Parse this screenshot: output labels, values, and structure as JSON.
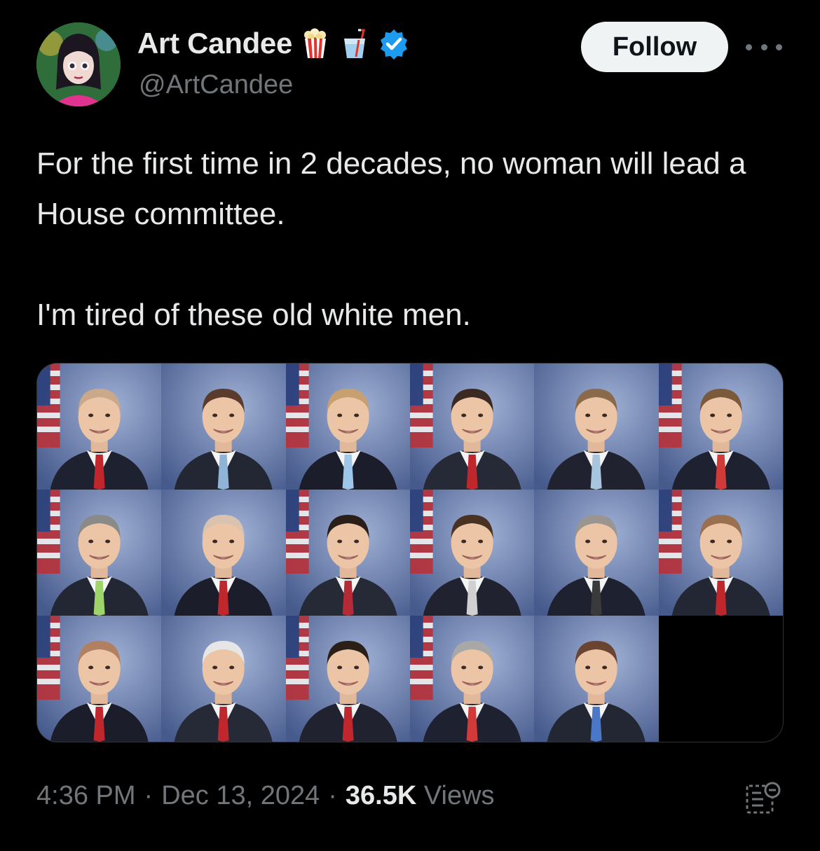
{
  "author": {
    "name": "Art Candee",
    "handle": "@ArtCandee",
    "badges": [
      "popcorn-icon",
      "cup-with-straw-icon",
      "verified-badge-icon"
    ]
  },
  "actions": {
    "follow_label": "Follow",
    "more_icon": "more-options-icon"
  },
  "tweet": {
    "line1": "For the first time in 2 decades, no woman will lead a House committee.",
    "line2": "I'm tired of these old white men."
  },
  "media": {
    "photo_count": 17,
    "columns": 6,
    "rows": 3
  },
  "meta": {
    "time": "4:36 PM",
    "separator": "·",
    "date": "Dec 13, 2024",
    "views_count": "36.5K",
    "views_label": "Views"
  },
  "colors": {
    "background": "#000000",
    "text": "#e7e9ea",
    "secondary": "#71767b",
    "verified": "#1d9bf0",
    "follow_bg": "#eff3f4"
  }
}
